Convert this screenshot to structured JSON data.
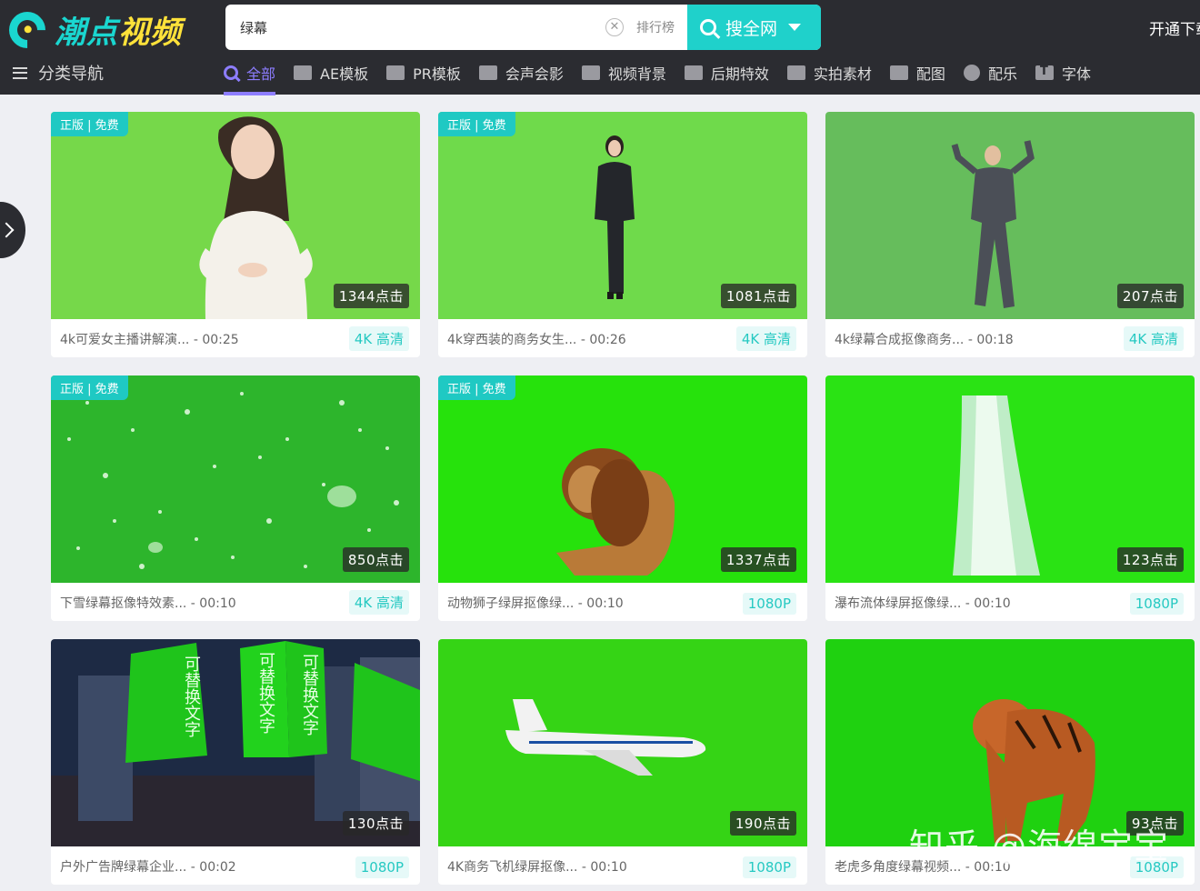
{
  "brand": {
    "name_a": "潮点",
    "name_b": "视频",
    "accent": "#1fd1cb"
  },
  "search": {
    "value": "绿幕",
    "clear": "✕",
    "rank_label": "排行榜",
    "button_label": "搜全网"
  },
  "header": {
    "vip_label": "开通下载"
  },
  "nav": {
    "category_label": "分类导航",
    "items": [
      {
        "label": "全部",
        "icon": "search-icon"
      },
      {
        "label": "AE模板",
        "icon": "ae-icon"
      },
      {
        "label": "PR模板",
        "icon": "pr-icon"
      },
      {
        "label": "会声会影",
        "icon": "video-editor-icon"
      },
      {
        "label": "视频背景",
        "icon": "background-icon"
      },
      {
        "label": "后期特效",
        "icon": "effects-icon"
      },
      {
        "label": "实拍素材",
        "icon": "camera-icon"
      },
      {
        "label": "配图",
        "icon": "image-icon"
      },
      {
        "label": "配乐",
        "icon": "music-icon"
      },
      {
        "label": "字体",
        "icon": "font-icon"
      }
    ]
  },
  "cards": [
    {
      "badge": "正版 | 免费",
      "clicks": "1344点击",
      "title": "4k可爱女主播讲解演... - 00:25",
      "quality": "4K 高清"
    },
    {
      "badge": "正版 | 免费",
      "clicks": "1081点击",
      "title": "4k穿西装的商务女生... - 00:26",
      "quality": "4K 高清"
    },
    {
      "badge": "",
      "clicks": "207点击",
      "title": "4k绿幕合成抠像商务... - 00:18",
      "quality": "4K 高清"
    },
    {
      "badge": "正版 | 免费",
      "clicks": "850点击",
      "title": "下雪绿幕抠像特效素... - 00:10",
      "quality": "4K 高清"
    },
    {
      "badge": "正版 | 免费",
      "clicks": "1337点击",
      "title": "动物狮子绿屏抠像绿... - 00:10",
      "quality": "1080P"
    },
    {
      "badge": "",
      "clicks": "123点击",
      "title": "瀑布流体绿屏抠像绿... - 00:10",
      "quality": "1080P"
    },
    {
      "badge": "",
      "clicks": "130点击",
      "title": "户外广告牌绿幕企业... - 00:02",
      "quality": "1080P"
    },
    {
      "badge": "",
      "clicks": "190点击",
      "title": "4K商务飞机绿屏抠像... - 00:10",
      "quality": "1080P"
    },
    {
      "badge": "",
      "clicks": "93点击",
      "title": "老虎多角度绿幕视频... - 00:10",
      "quality": "1080P"
    }
  ],
  "billboard_text": "可替换文字",
  "watermark": "知乎 @海绵宝宝"
}
